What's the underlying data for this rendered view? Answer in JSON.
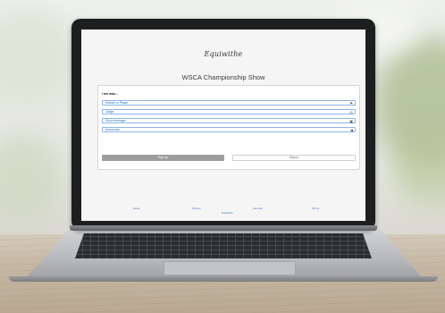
{
  "site": {
    "logo_text": "Equiwithe",
    "title": "WSCA Championship Show"
  },
  "form": {
    "prompt": "I am a/an...",
    "roles": [
      {
        "label": "Entrant or Player",
        "icon": "bookmark-icon"
      },
      {
        "label": "Judge",
        "icon": "gavel-icon"
      },
      {
        "label": "Show manager",
        "icon": "clipboard-icon"
      },
      {
        "label": "Announcer",
        "icon": "megaphone-icon"
      }
    ],
    "signup_label": "Sign up",
    "signin_label": "Sign in"
  },
  "footer": {
    "links": [
      "News",
      "Privacy",
      "Security",
      "Terms"
    ],
    "sublink": "Equiwithe"
  },
  "colors": {
    "accent": "#2d6db5",
    "field_border": "#8cb4e8",
    "signup_bg": "#9d9d9d"
  }
}
